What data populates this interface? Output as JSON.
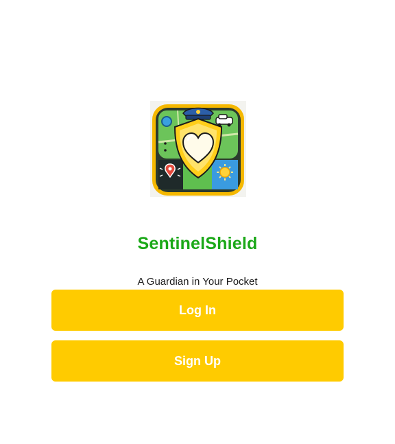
{
  "app": {
    "name": "SentinelShield",
    "tagline": "A Guardian in Your Pocket",
    "logo_icon": "shield-heart-logo-icon"
  },
  "actions": {
    "login_label": "Log In",
    "signup_label": "Sign Up"
  },
  "colors": {
    "brand_green": "#1ba818",
    "button_yellow": "#ffcb00",
    "button_text": "#ffffff",
    "background": "#ffffff"
  }
}
